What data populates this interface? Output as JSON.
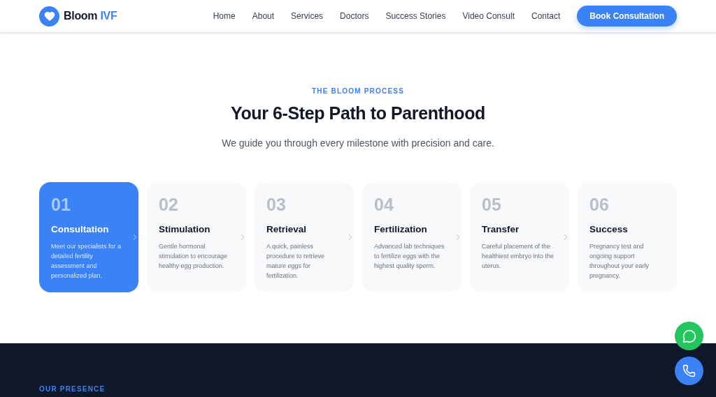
{
  "header": {
    "logo": {
      "name": "Bloom",
      "accent": "IVF"
    },
    "nav": [
      {
        "label": "Home"
      },
      {
        "label": "About"
      },
      {
        "label": "Services"
      },
      {
        "label": "Doctors"
      },
      {
        "label": "Success Stories"
      },
      {
        "label": "Video Consult"
      },
      {
        "label": "Contact"
      }
    ],
    "cta": "Book Consultation"
  },
  "process": {
    "eyebrow": "THE BLOOM PROCESS",
    "title": "Your 6-Step Path to Parenthood",
    "subtitle": "We guide you through every milestone with precision and care.",
    "steps": [
      {
        "number": "01",
        "title": "Consultation",
        "text": "Meet our specialists for a detailed fertility assessment and personalized plan.",
        "selected": true
      },
      {
        "number": "02",
        "title": "Stimulation",
        "text": "Gentle hormonal stimulation to encourage healthy egg production.",
        "selected": false
      },
      {
        "number": "03",
        "title": "Retrieval",
        "text": "A quick, painless procedure to retrieve mature eggs for fertilization.",
        "selected": false
      },
      {
        "number": "04",
        "title": "Fertilization",
        "text": "Advanced lab techniques to fertilize eggs with the highest quality sperm.",
        "selected": false
      },
      {
        "number": "05",
        "title": "Transfer",
        "text": "Careful placement of the healthiest embryo into the uterus.",
        "selected": false
      },
      {
        "number": "06",
        "title": "Success",
        "text": "Pregnancy test and ongoing support throughout your early pregnancy.",
        "selected": false
      }
    ]
  },
  "presence": {
    "eyebrow": "OUR PRESENCE"
  }
}
